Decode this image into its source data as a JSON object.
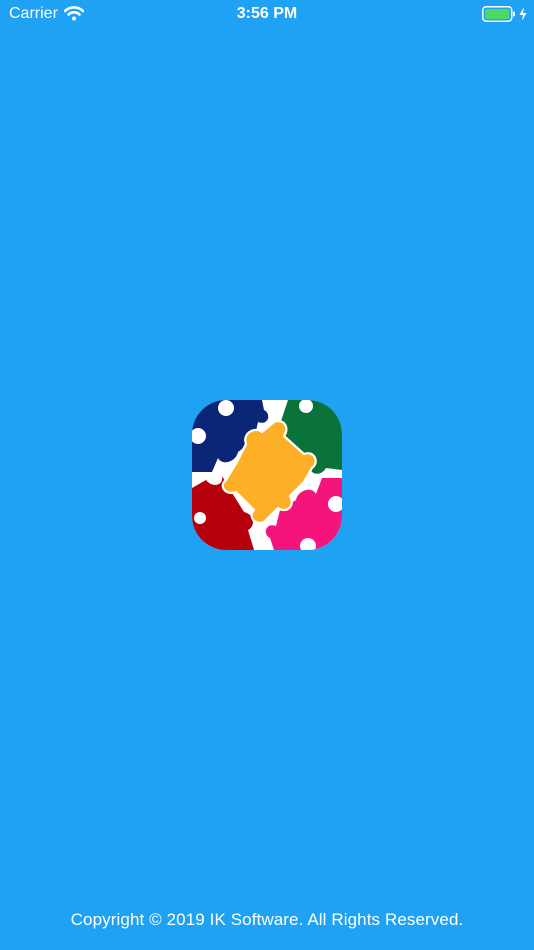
{
  "status_bar": {
    "carrier": "Carrier",
    "time": "3:56 PM",
    "battery_color": "#4CD964"
  },
  "splash": {
    "background_color": "#1FA2F3",
    "logo_icon": "puzzle-pieces-icon",
    "logo_colors": {
      "navy": "#0B2577",
      "green": "#0A7339",
      "yellow": "#FDB027",
      "red": "#B5000B",
      "pink": "#F5137C"
    },
    "copyright": "Copyright  © 2019 IK Software. All Rights Reserved."
  }
}
